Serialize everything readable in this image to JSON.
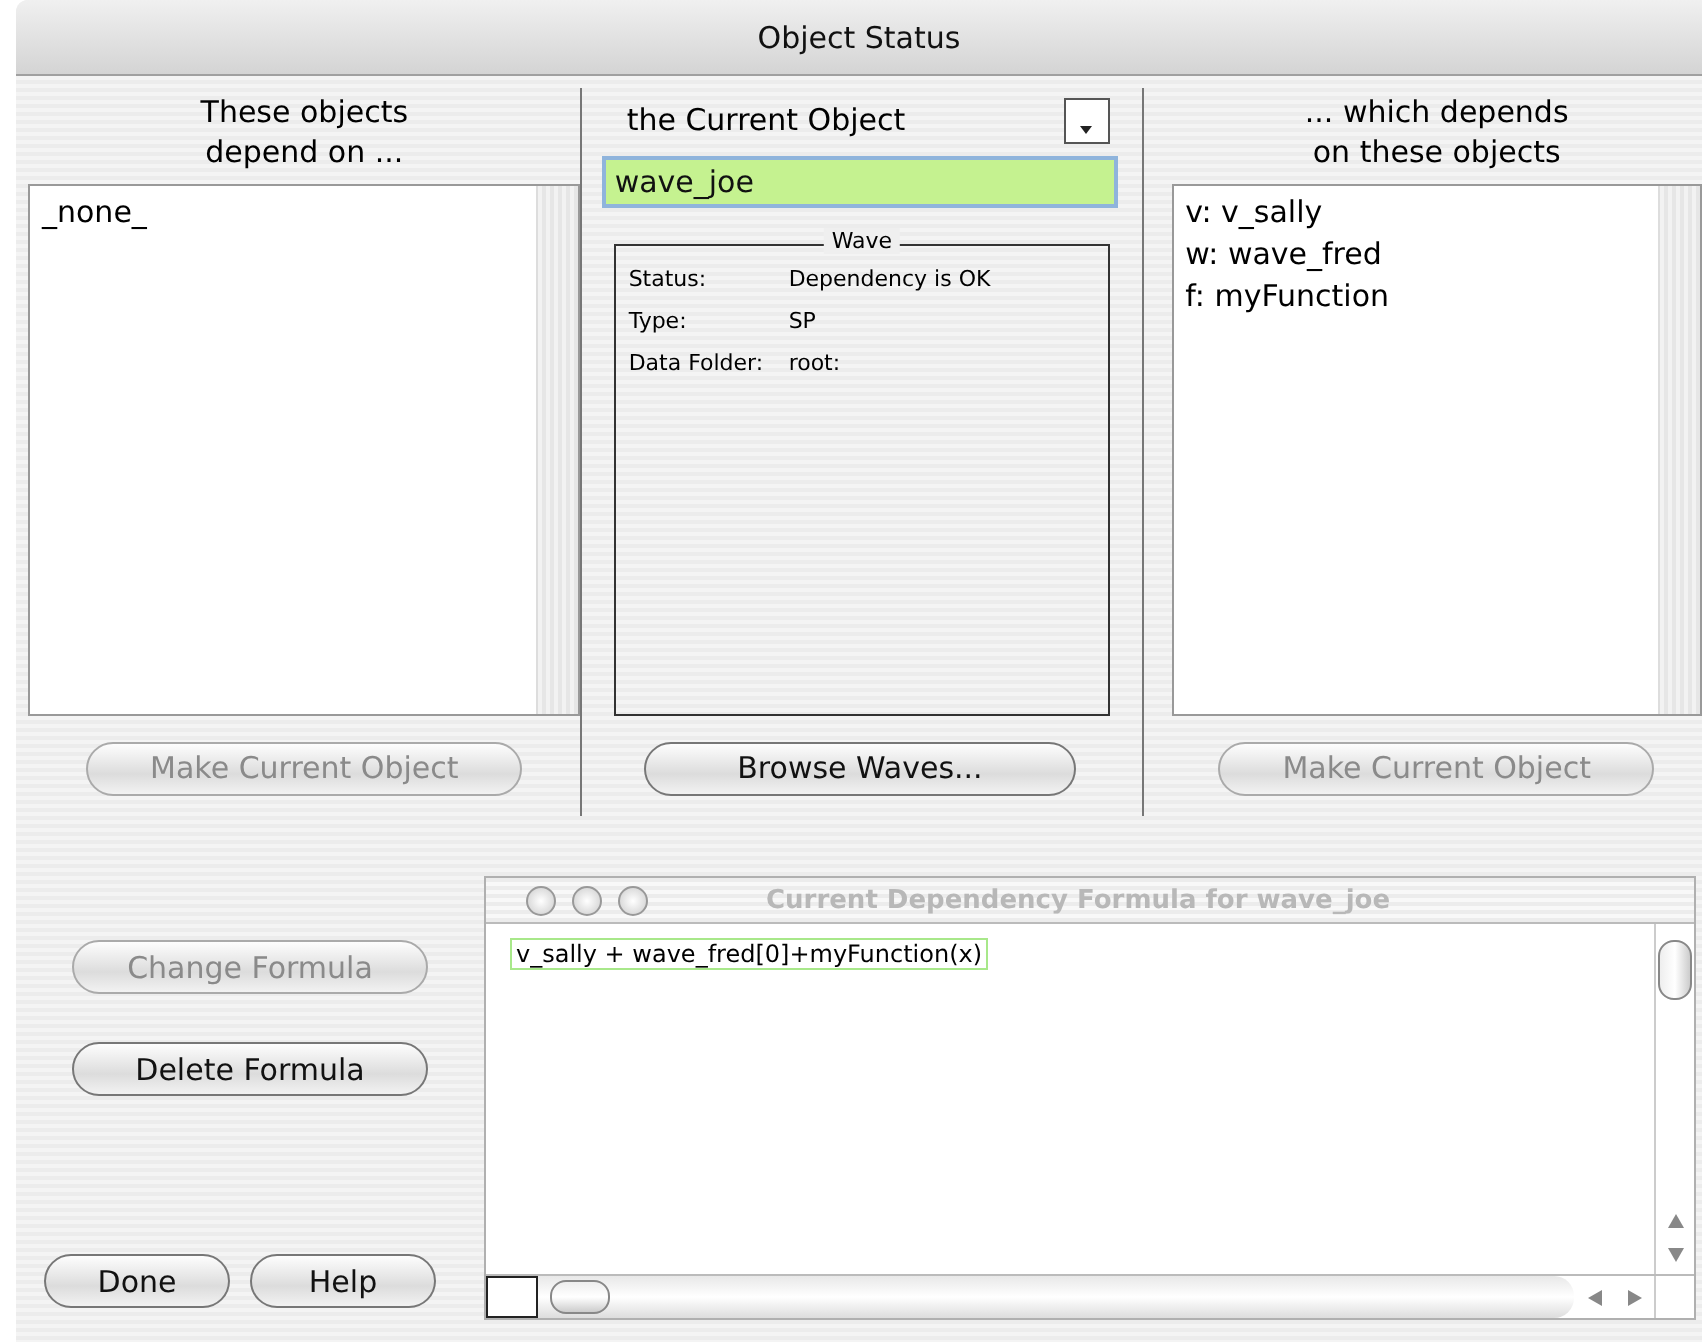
{
  "window": {
    "title": "Object Status"
  },
  "left_panel": {
    "heading_lines": [
      "These objects",
      "depend on ..."
    ],
    "items": [
      "_none_"
    ],
    "button": {
      "label": "Make Current Object",
      "disabled": true
    }
  },
  "center_panel": {
    "heading": "the Current Object",
    "object_field": {
      "value": "wave_joe"
    },
    "info_box": {
      "title": "Wave",
      "rows": [
        {
          "label": "Status:",
          "value": "Dependency is OK"
        },
        {
          "label": "Type:",
          "value": "SP"
        },
        {
          "label": "Data Folder:",
          "value": "root:"
        }
      ]
    },
    "button": {
      "label": "Browse Waves...",
      "disabled": false
    }
  },
  "right_panel": {
    "heading_lines": [
      "... which depends",
      "on these objects"
    ],
    "items": [
      "v: v_sally",
      "w: wave_fred",
      "f: myFunction"
    ],
    "button": {
      "label": "Make Current Object",
      "disabled": true
    }
  },
  "formula_buttons": [
    {
      "label": "Change Formula",
      "disabled": true
    },
    {
      "label": "Delete Formula",
      "disabled": false
    }
  ],
  "bottom_buttons": [
    {
      "label": "Done",
      "disabled": false
    },
    {
      "label": "Help",
      "disabled": false
    }
  ],
  "formula_window": {
    "title": "Current Dependency Formula for wave_joe",
    "formula": "v_sally + wave_fred[0]+myFunction(x)"
  }
}
